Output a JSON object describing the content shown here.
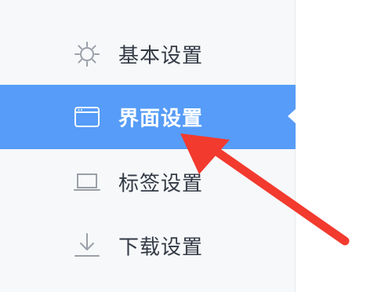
{
  "sidebar": {
    "items": [
      {
        "label": "基本设置",
        "icon": "gear-icon",
        "active": false
      },
      {
        "label": "界面设置",
        "icon": "window-icon",
        "active": true
      },
      {
        "label": "标签设置",
        "icon": "laptop-icon",
        "active": false
      },
      {
        "label": "下载设置",
        "icon": "download-icon",
        "active": false
      }
    ]
  },
  "colors": {
    "active_background": "#569cf8",
    "annotation_arrow": "#f23a2e",
    "sidebar_background": "#f7f8fa",
    "label_text": "#333a45"
  }
}
